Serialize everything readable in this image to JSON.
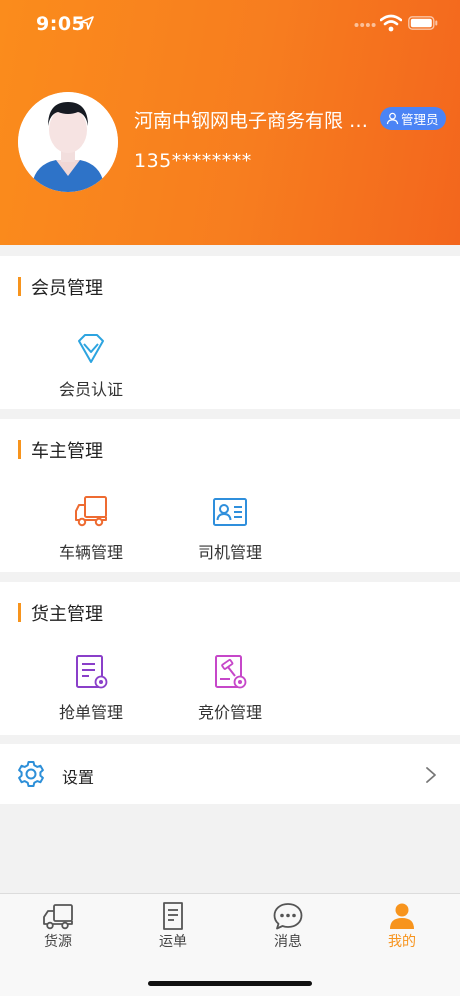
{
  "status_bar": {
    "time": "9:05"
  },
  "profile": {
    "company": "河南中钢网电子商务有限 …",
    "role": "管理员",
    "phone": "135********"
  },
  "sections": [
    {
      "title": "会员管理",
      "items": [
        {
          "label": "会员认证",
          "icon": "diamond-icon"
        }
      ]
    },
    {
      "title": "车主管理",
      "items": [
        {
          "label": "车辆管理",
          "icon": "truck-icon"
        },
        {
          "label": "司机管理",
          "icon": "id-card-icon"
        }
      ]
    },
    {
      "title": "货主管理",
      "items": [
        {
          "label": "抢单管理",
          "icon": "grab-order-icon"
        },
        {
          "label": "竞价管理",
          "icon": "auction-icon"
        }
      ]
    }
  ],
  "settings": {
    "label": "设置",
    "icon": "gear-icon"
  },
  "tabbar": {
    "active": "我的",
    "tabs": [
      {
        "label": "货源",
        "icon": "truck-icon"
      },
      {
        "label": "运单",
        "icon": "document-icon"
      },
      {
        "label": "消息",
        "icon": "chat-icon"
      },
      {
        "label": "我的",
        "icon": "person-icon"
      }
    ]
  },
  "colors": {
    "accent": "#f7941d",
    "badge": "#4b84f5"
  }
}
